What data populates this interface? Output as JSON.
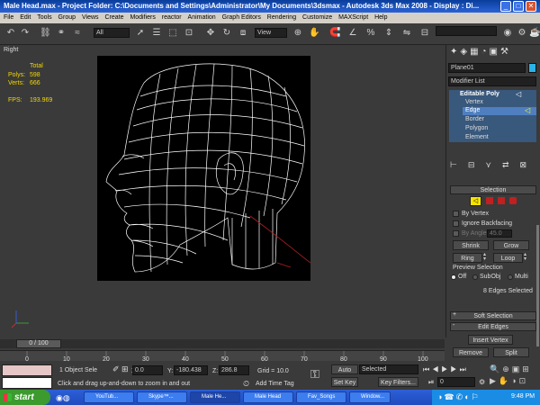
{
  "window": {
    "title": "Male Head.max - Project Folder: C:\\Documents and Settings\\Administrator\\My Documents\\3dsmax - Autodesk 3ds Max 2008 - Display : Di..."
  },
  "menu": [
    "File",
    "Edit",
    "Tools",
    "Group",
    "Views",
    "Create",
    "Modifiers",
    "reactor",
    "Animation",
    "Graph Editors",
    "Rendering",
    "Customize",
    "MAXScript",
    "Help"
  ],
  "toolbar": {
    "selection_filter": "All",
    "ref_coord": "View"
  },
  "viewport": {
    "label": "Right",
    "stats": {
      "total_label": "Total",
      "polys_label": "Polys:",
      "polys_value": "598",
      "verts_label": "Verts:",
      "verts_value": "666",
      "fps_label": "FPS:",
      "fps_value": "193.969"
    }
  },
  "command_panel": {
    "object_name": "Plane01",
    "modifier_list": "Modifier List",
    "stack": [
      "Editable Poly",
      "Vertex",
      "Edge",
      "Border",
      "Polygon",
      "Element"
    ],
    "selection_rollout": "Selection",
    "by_vertex": "By Vertex",
    "ignore_backfacing": "Ignore Backfacing",
    "by_angle": "By Angle:",
    "by_angle_value": "45.0",
    "shrink": "Shrink",
    "grow": "Grow",
    "ring": "Ring",
    "loop": "Loop",
    "preview_selection": "Preview Selection",
    "preview_off": "Off",
    "preview_subobj": "SubObj",
    "preview_multi": "Multi",
    "edges_selected": "8 Edges Selected",
    "soft_selection": "Soft Selection",
    "edit_edges": "Edit Edges",
    "insert_vertex": "Insert Vertex",
    "remove": "Remove",
    "split": "Split"
  },
  "timeline": {
    "frame": "0 / 100",
    "ticks": [
      "0",
      "10",
      "20",
      "30",
      "40",
      "50",
      "60",
      "70",
      "80",
      "90",
      "100"
    ]
  },
  "status": {
    "selected_count": "1 Object Sele",
    "prompt": "Click and drag up-and-down to zoom in and out",
    "x_label": "X:",
    "x_value": "0.0",
    "y_label": "Y:",
    "y_value": "-180.438",
    "z_label": "Z:",
    "z_value": "286.8",
    "grid": "Grid = 10.0",
    "add_time_tag": "Add Time Tag",
    "auto_key": "Auto Key",
    "selected": "Selected",
    "set_key": "Set Key",
    "key_filters": "Key Filters...",
    "frame_field": "0"
  },
  "taskbar": {
    "start": "start",
    "tasks": [
      "YouTub...",
      "Skype™...",
      "Male He...",
      "Male Head",
      "Fav_Songs",
      "Window..."
    ],
    "clock": "9:48 PM"
  }
}
